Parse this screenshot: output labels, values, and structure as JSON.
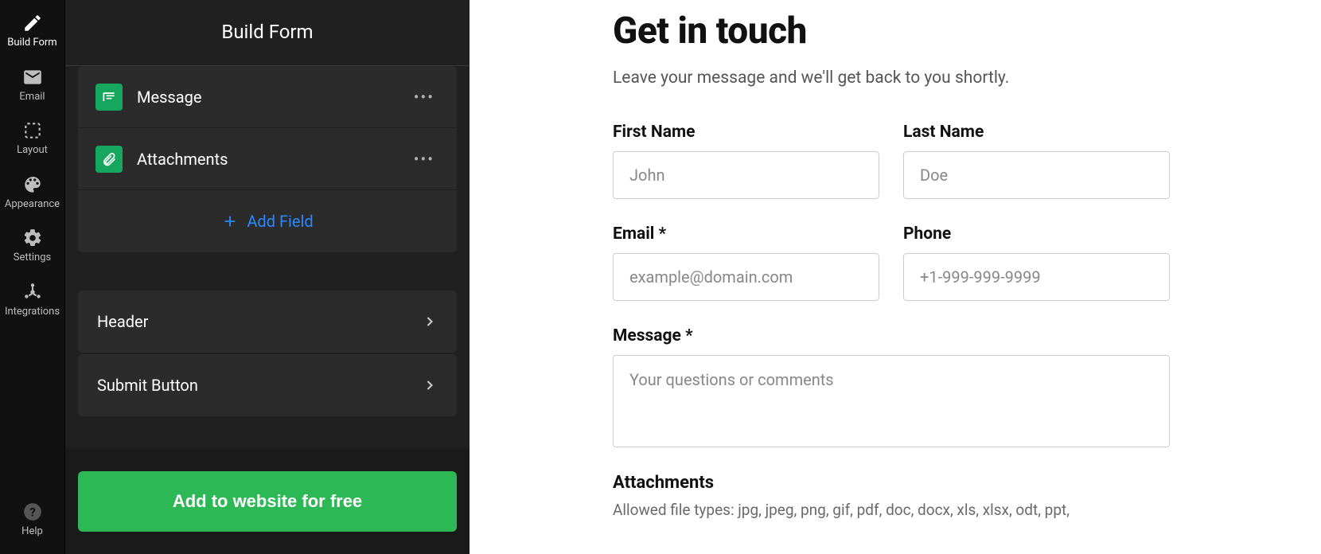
{
  "rail": {
    "items": [
      {
        "id": "build",
        "label": "Build Form",
        "active": true
      },
      {
        "id": "email",
        "label": "Email"
      },
      {
        "id": "layout",
        "label": "Layout"
      },
      {
        "id": "appearance",
        "label": "Appearance"
      },
      {
        "id": "settings",
        "label": "Settings"
      },
      {
        "id": "integrations",
        "label": "Integrations"
      },
      {
        "id": "help",
        "label": "Help"
      }
    ]
  },
  "panel": {
    "title": "Build Form",
    "fields": [
      {
        "id": "message",
        "label": "Message",
        "icon": "textarea"
      },
      {
        "id": "attachments",
        "label": "Attachments",
        "icon": "paperclip"
      }
    ],
    "add_field_label": "Add Field",
    "sections": [
      {
        "id": "header",
        "label": "Header"
      },
      {
        "id": "submit",
        "label": "Submit Button"
      }
    ],
    "cta_label": "Add to website for free"
  },
  "preview": {
    "title": "Get in touch",
    "subtitle": "Leave your message and we'll get back to you shortly.",
    "fields": {
      "first_name": {
        "label": "First Name",
        "placeholder": "John"
      },
      "last_name": {
        "label": "Last Name",
        "placeholder": "Doe"
      },
      "email": {
        "label": "Email *",
        "placeholder": "example@domain.com"
      },
      "phone": {
        "label": "Phone",
        "placeholder": "+1-999-999-9999"
      },
      "message": {
        "label": "Message *",
        "placeholder": "Your questions or comments"
      },
      "attachments": {
        "label": "Attachments",
        "help": "Allowed file types: jpg, jpeg, png, gif, pdf, doc, docx, xls, xlsx, odt, ppt,"
      }
    }
  }
}
